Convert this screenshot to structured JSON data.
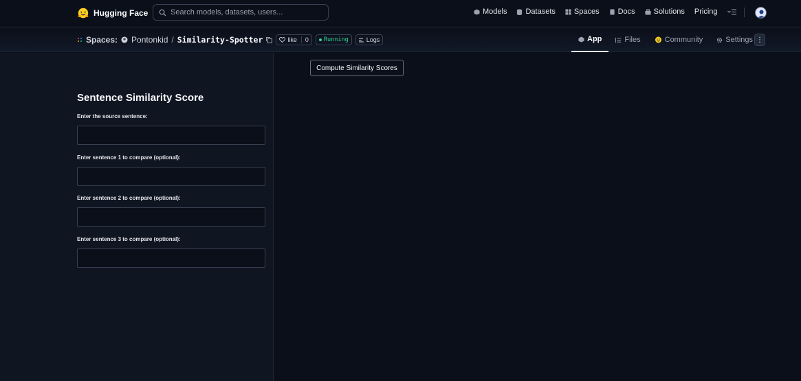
{
  "topnav": {
    "brand": "Hugging Face",
    "search_placeholder": "Search models, datasets, users...",
    "links": [
      "Models",
      "Datasets",
      "Spaces",
      "Docs",
      "Solutions",
      "Pricing"
    ]
  },
  "spacebar": {
    "spaces_label": "Spaces:",
    "owner": "Pontonkid",
    "separator": "/",
    "repo": "Similarity-Spotter",
    "like_label": "like",
    "like_count": "0",
    "status": "Running",
    "logs_label": "Logs",
    "tabs": [
      "App",
      "Files",
      "Community",
      "Settings"
    ]
  },
  "app": {
    "title": "Sentence Similarity Score",
    "fields": [
      {
        "label": "Enter the source sentence:",
        "value": ""
      },
      {
        "label": "Enter sentence 1 to compare (optional):",
        "value": ""
      },
      {
        "label": "Enter sentence 2 to compare (optional):",
        "value": ""
      },
      {
        "label": "Enter sentence 3 to compare (optional):",
        "value": ""
      }
    ],
    "button_label": "Compute Similarity Scores"
  },
  "colors": {
    "background": "#0b0f19",
    "panel": "#101522",
    "running": "#34d399"
  }
}
